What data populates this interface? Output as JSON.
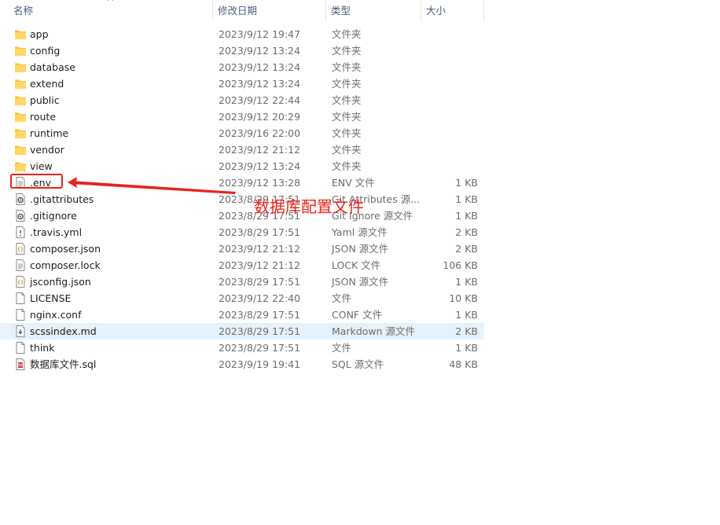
{
  "columns": {
    "name": "名称",
    "date": "修改日期",
    "type": "类型",
    "size": "大小"
  },
  "files": [
    {
      "name": "app",
      "date": "2023/9/12 19:47",
      "type": "文件夹",
      "size": "",
      "icon": "folder-icon"
    },
    {
      "name": "config",
      "date": "2023/9/12 13:24",
      "type": "文件夹",
      "size": "",
      "icon": "folder-icon"
    },
    {
      "name": "database",
      "date": "2023/9/12 13:24",
      "type": "文件夹",
      "size": "",
      "icon": "folder-icon"
    },
    {
      "name": "extend",
      "date": "2023/9/12 13:24",
      "type": "文件夹",
      "size": "",
      "icon": "folder-icon"
    },
    {
      "name": "public",
      "date": "2023/9/12 22:44",
      "type": "文件夹",
      "size": "",
      "icon": "folder-icon"
    },
    {
      "name": "route",
      "date": "2023/9/12 20:29",
      "type": "文件夹",
      "size": "",
      "icon": "folder-icon"
    },
    {
      "name": "runtime",
      "date": "2023/9/16 22:00",
      "type": "文件夹",
      "size": "",
      "icon": "folder-icon"
    },
    {
      "name": "vendor",
      "date": "2023/9/12 21:12",
      "type": "文件夹",
      "size": "",
      "icon": "folder-icon"
    },
    {
      "name": "view",
      "date": "2023/9/12 13:24",
      "type": "文件夹",
      "size": "",
      "icon": "folder-icon"
    },
    {
      "name": ".env",
      "date": "2023/9/12 13:28",
      "type": "ENV 文件",
      "size": "1 KB",
      "icon": "text-file-icon"
    },
    {
      "name": ".gitattributes",
      "date": "2023/8/29 17:51",
      "type": "Git Attributes 源...",
      "size": "1 KB",
      "icon": "settings-file-icon"
    },
    {
      "name": ".gitignore",
      "date": "2023/8/29 17:51",
      "type": "Git Ignore 源文件",
      "size": "1 KB",
      "icon": "settings-file-icon"
    },
    {
      "name": ".travis.yml",
      "date": "2023/8/29 17:51",
      "type": "Yaml 源文件",
      "size": "2 KB",
      "icon": "yaml-file-icon"
    },
    {
      "name": "composer.json",
      "date": "2023/9/12 21:12",
      "type": "JSON 源文件",
      "size": "2 KB",
      "icon": "json-file-icon"
    },
    {
      "name": "composer.lock",
      "date": "2023/9/12 21:12",
      "type": "LOCK 文件",
      "size": "106 KB",
      "icon": "text-file-icon"
    },
    {
      "name": "jsconfig.json",
      "date": "2023/8/29 17:51",
      "type": "JSON 源文件",
      "size": "1 KB",
      "icon": "json-file-icon"
    },
    {
      "name": "LICENSE",
      "date": "2023/9/12 22:40",
      "type": "文件",
      "size": "10 KB",
      "icon": "blank-file-icon"
    },
    {
      "name": "nginx.conf",
      "date": "2023/8/29 17:51",
      "type": "CONF 文件",
      "size": "1 KB",
      "icon": "blank-file-icon"
    },
    {
      "name": "scssindex.md",
      "date": "2023/8/29 17:51",
      "type": "Markdown 源文件",
      "size": "2 KB",
      "icon": "markdown-file-icon",
      "hover": true
    },
    {
      "name": "think",
      "date": "2023/8/29 17:51",
      "type": "文件",
      "size": "1 KB",
      "icon": "blank-file-icon"
    },
    {
      "name": "数据库文件.sql",
      "date": "2023/9/19 19:41",
      "type": "SQL 源文件",
      "size": "48 KB",
      "icon": "sql-file-icon"
    }
  ],
  "annotation": {
    "text": "数据库配置文件",
    "color": "#e8231d"
  },
  "colors": {
    "folder": "#f6c443",
    "header_text": "#4c607a",
    "hover_row": "#e5f1fb"
  }
}
